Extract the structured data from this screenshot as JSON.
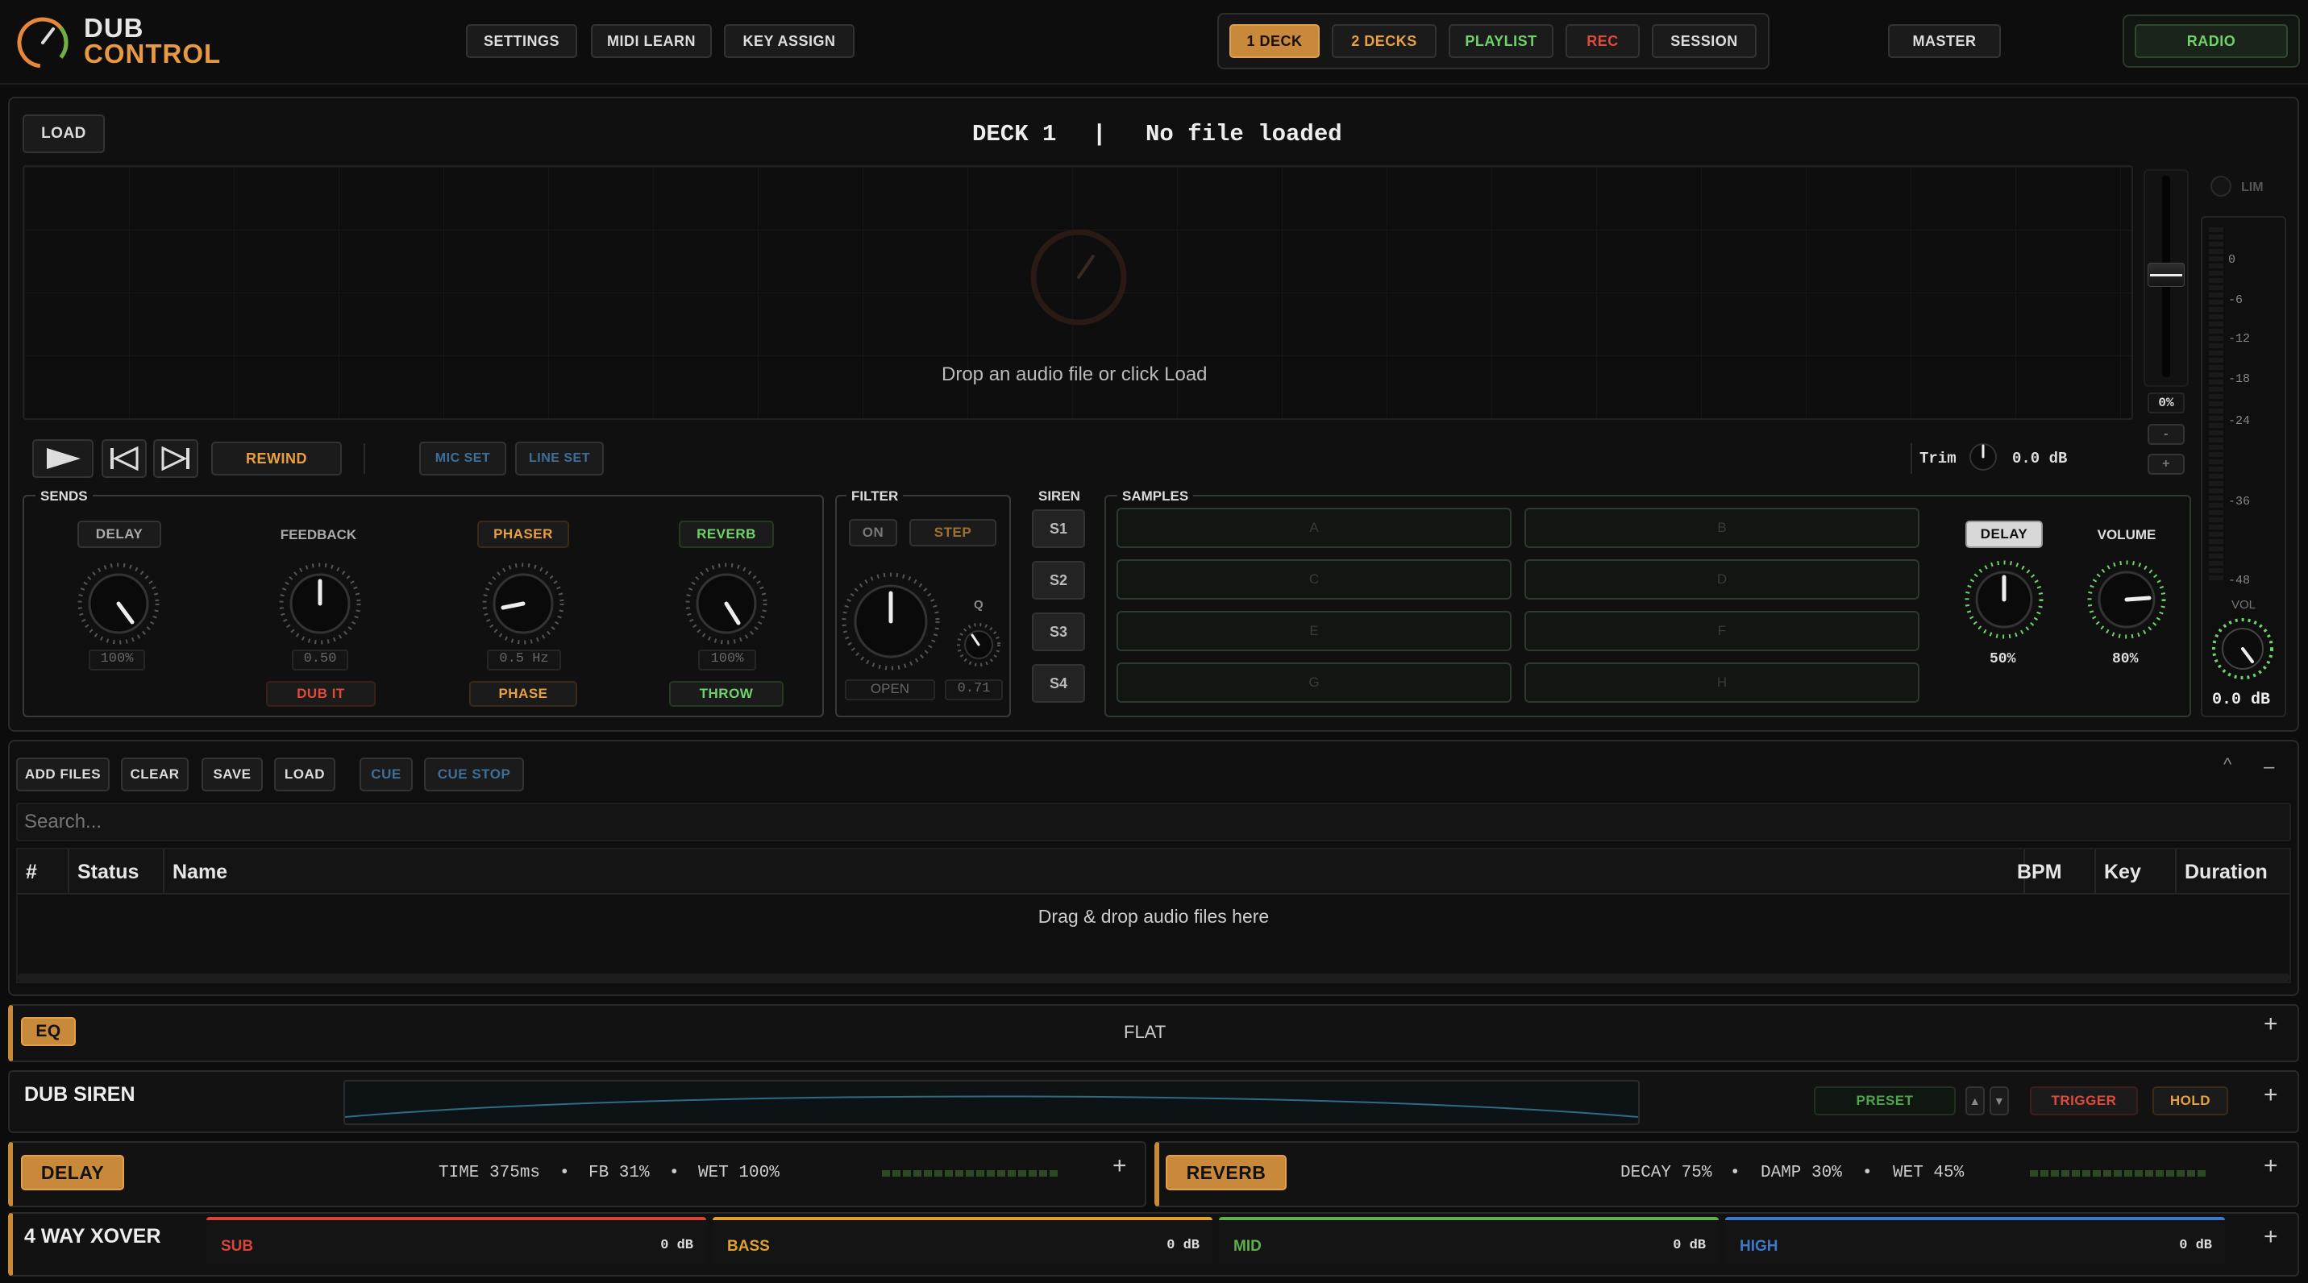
{
  "app": {
    "name_line1": "DUB",
    "name_line2": "CONTROL"
  },
  "topbar": {
    "settings": "SETTINGS",
    "midi_learn": "MIDI LEARN",
    "key_assign": "KEY ASSIGN",
    "deck1": "1 DECK",
    "deck2": "2 DECKS",
    "playlist": "PLAYLIST",
    "rec": "REC",
    "session": "SESSION",
    "master": "MASTER",
    "radio": "RADIO"
  },
  "deck": {
    "load": "LOAD",
    "title": "DECK 1",
    "separator": "|",
    "file_status": "No file loaded",
    "drop_hint": "Drop an audio file or click Load",
    "pitch_value": "0%",
    "pitch_minus": "-",
    "pitch_plus": "+",
    "lim": "LIM",
    "transport": {
      "rewind": "REWIND",
      "mic_set": "MIC SET",
      "line_set": "LINE SET"
    },
    "trim": {
      "label": "Trim",
      "value": "0.0 dB"
    },
    "meter": {
      "scale": [
        "0",
        "-6",
        "-12",
        "-18",
        "-24",
        "-36",
        "-48"
      ],
      "vol_label": "VOL",
      "vol_value": "0.0 dB"
    }
  },
  "sends": {
    "title": "SENDS",
    "delay": {
      "label": "DELAY",
      "value": "100%"
    },
    "feedback": {
      "label": "FEEDBACK",
      "value": "0.50",
      "button": "DUB IT"
    },
    "phaser": {
      "label": "PHASER",
      "value": "0.5 Hz",
      "button": "PHASE"
    },
    "reverb": {
      "label": "REVERB",
      "value": "100%",
      "button": "THROW"
    }
  },
  "filter": {
    "title": "FILTER",
    "on": "ON",
    "step": "STEP",
    "q_label": "Q",
    "mode": "OPEN",
    "q_value": "0.71"
  },
  "siren": {
    "title": "SIREN",
    "buttons": [
      "S1",
      "S2",
      "S3",
      "S4"
    ]
  },
  "samples": {
    "title": "SAMPLES",
    "pads": [
      "A",
      "B",
      "C",
      "D",
      "E",
      "F",
      "G",
      "H"
    ],
    "delay_button": "DELAY",
    "volume_label": "VOLUME",
    "delay_value": "50%",
    "volume_value": "80%"
  },
  "playlist": {
    "add_files": "ADD FILES",
    "clear": "CLEAR",
    "save": "SAVE",
    "load": "LOAD",
    "cue": "CUE",
    "cue_stop": "CUE STOP",
    "collapse": "^",
    "minimize": "–",
    "search_placeholder": "Search...",
    "columns": [
      "#",
      "Status",
      "Name",
      "BPM",
      "Key",
      "Duration"
    ],
    "empty_hint": "Drag & drop audio files here"
  },
  "eq": {
    "label": "EQ",
    "preset": "FLAT",
    "expand": "+"
  },
  "dub_siren": {
    "label": "DUB SIREN",
    "preset": "PRESET",
    "up": "▲",
    "down": "▼",
    "trigger": "TRIGGER",
    "hold": "HOLD",
    "expand": "+"
  },
  "delay_fx": {
    "label": "DELAY",
    "time": "TIME 375ms",
    "dot1": "•",
    "fb": "FB 31%",
    "dot2": "•",
    "wet": "WET 100%",
    "expand": "+"
  },
  "reverb_fx": {
    "label": "REVERB",
    "decay": "DECAY 75%",
    "dot1": "•",
    "damp": "DAMP 30%",
    "dot2": "•",
    "wet": "WET 45%",
    "expand": "+"
  },
  "xover": {
    "label": "4 WAY XOVER",
    "expand": "+",
    "bands": [
      {
        "name": "SUB",
        "value": "0 dB",
        "color": "#d9443a"
      },
      {
        "name": "BASS",
        "value": "0 dB",
        "color": "#e0a030"
      },
      {
        "name": "MID",
        "value": "0 dB",
        "color": "#5fb04a"
      },
      {
        "name": "HIGH",
        "value": "0 dB",
        "color": "#3f78c8"
      }
    ]
  },
  "colors": {
    "accent_orange": "#e8a040",
    "green": "#6fd36a",
    "red": "#e04a3a"
  }
}
